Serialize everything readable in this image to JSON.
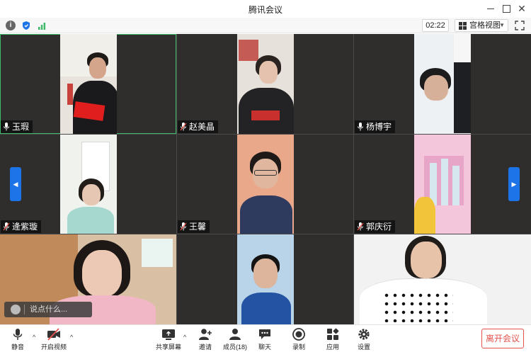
{
  "window": {
    "title": "腾讯会议"
  },
  "infobar": {
    "timer": "02:22",
    "view_label": "宫格视图"
  },
  "participants": [
    {
      "name": "玉瑕",
      "mic": "on"
    },
    {
      "name": "赵美晶",
      "mic": "muted"
    },
    {
      "name": "杨博宇",
      "mic": "on"
    },
    {
      "name": "逄紫璇",
      "mic": "muted"
    },
    {
      "name": "王馨",
      "mic": "muted"
    },
    {
      "name": "郭庆衍",
      "mic": "muted"
    }
  ],
  "chat_input": {
    "placeholder": "说点什么..."
  },
  "toolbar": {
    "mute": "静音",
    "video": "开启视频",
    "share": "共享屏幕",
    "invite": "邀请",
    "members": "成员(18)",
    "chat": "聊天",
    "record": "录制",
    "apps": "应用",
    "settings": "设置",
    "leave": "离开会议"
  },
  "colors": {
    "accent_blue": "#1d73e8",
    "leave_red": "#e4534b",
    "active_border": "#3fb96a"
  }
}
